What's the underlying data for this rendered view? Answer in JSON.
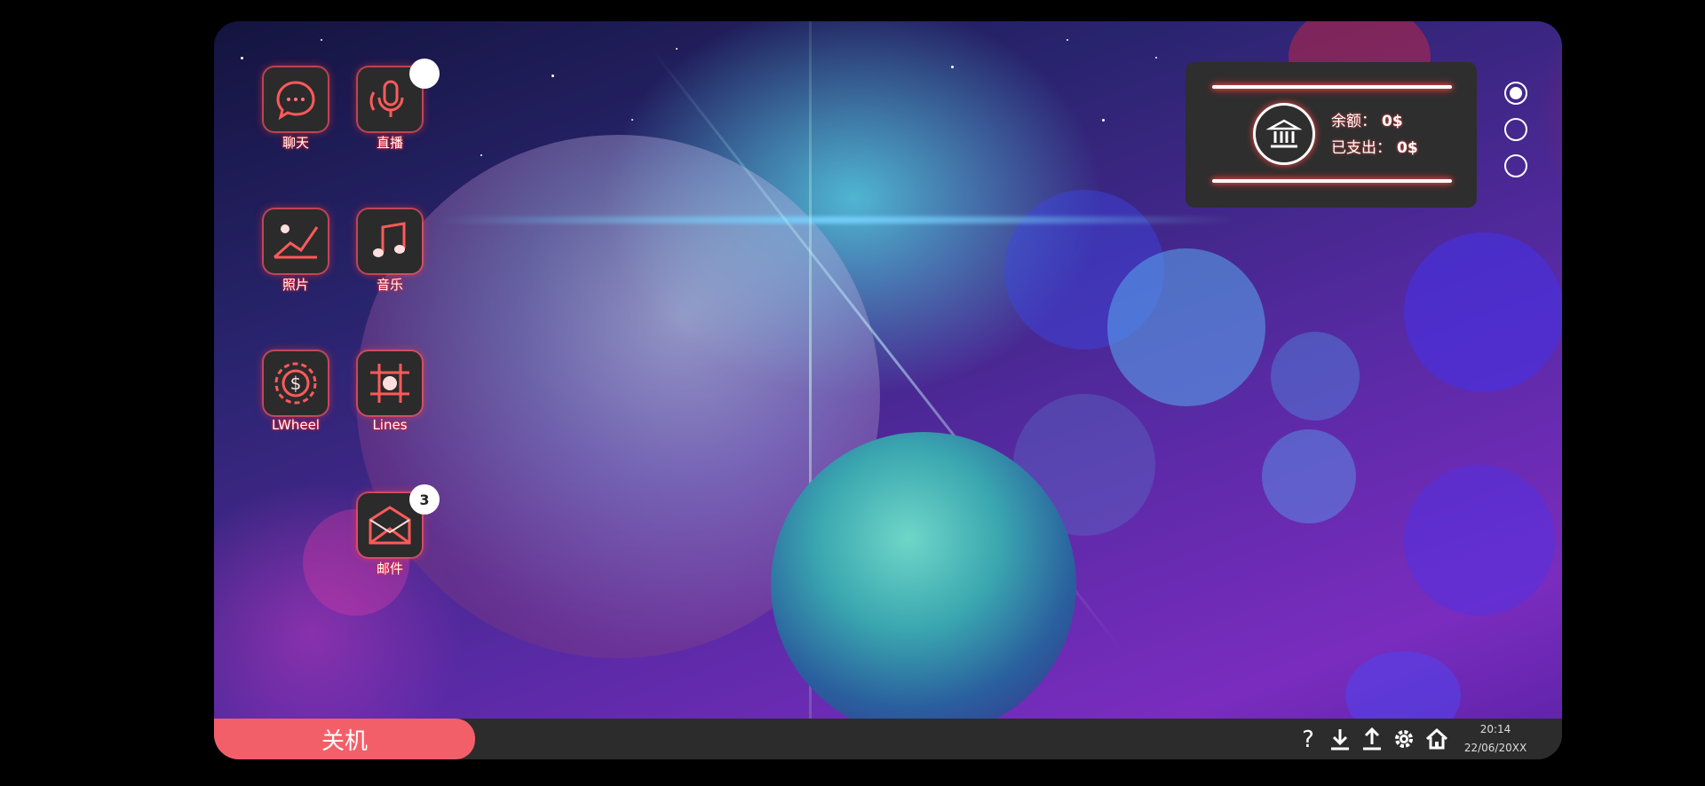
{
  "apps": [
    {
      "id": "chat",
      "label": "聊天",
      "icon": "chat-bubble-icon"
    },
    {
      "id": "live",
      "label": "直播",
      "icon": "microphone-icon",
      "badge": ""
    },
    {
      "id": "photos",
      "label": "照片",
      "icon": "image-icon"
    },
    {
      "id": "music",
      "label": "音乐",
      "icon": "music-note-icon"
    },
    {
      "id": "lwheel",
      "label": "LWheel",
      "icon": "casino-chip-icon"
    },
    {
      "id": "lines",
      "label": "Lines",
      "icon": "grid-target-icon"
    },
    {
      "id": "mail",
      "label": "邮件",
      "icon": "envelope-icon",
      "badge": "3"
    }
  ],
  "bank": {
    "icon": "bank-icon",
    "balance_label": "余额：",
    "balance_value": "0$",
    "spent_label": "已支出：",
    "spent_value": "0$"
  },
  "pager": {
    "count": 3,
    "active": 0
  },
  "taskbar": {
    "shutdown_label": "关机",
    "icons": [
      "help-icon",
      "download-icon",
      "upload-icon",
      "gear-icon",
      "home-icon"
    ],
    "time": "20:14",
    "date": "22/06/20XX"
  },
  "colors": {
    "accent": "#f35f69",
    "glow": "#ff3b3b",
    "panel": "#2e2e2e",
    "taskbar": "#2c2c2c"
  }
}
